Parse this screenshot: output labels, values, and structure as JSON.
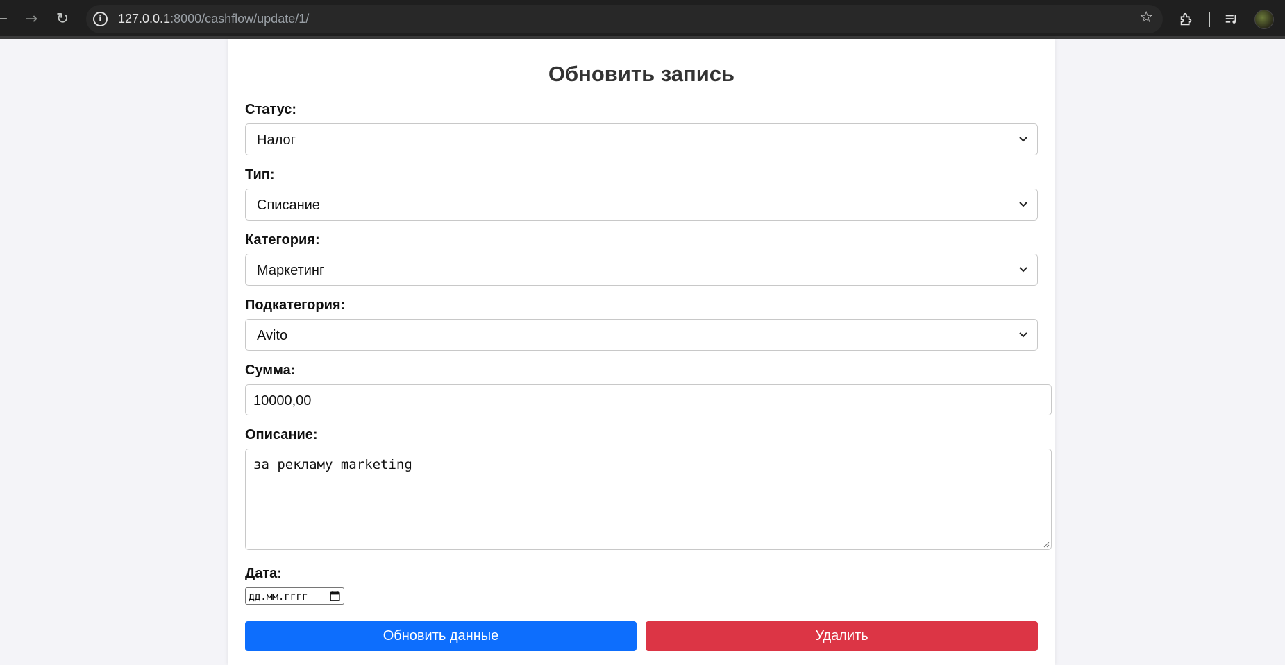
{
  "browser": {
    "url_host": "127.0.0.1",
    "url_rest": ":8000/cashflow/update/1/",
    "back_icon": "back-arrow-icon",
    "forward_icon": "forward-arrow-icon",
    "reload_icon": "reload-icon",
    "site_info_icon": "info-icon",
    "bookmark_icon": "star-icon",
    "extensions_icon": "puzzle-icon",
    "media_icon": "media-queue-icon",
    "profile_icon": "avatar"
  },
  "form": {
    "title": "Обновить запись",
    "status": {
      "label": "Статус:",
      "value": "Налог"
    },
    "type": {
      "label": "Тип:",
      "value": "Списание"
    },
    "category": {
      "label": "Категория:",
      "value": "Маркетинг"
    },
    "subcategory": {
      "label": "Подкатегория:",
      "value": "Avito"
    },
    "amount": {
      "label": "Сумма:",
      "value": "10000,00"
    },
    "description": {
      "label": "Описание:",
      "value": "за рекламу marketing"
    },
    "date": {
      "label": "Дата:",
      "placeholder": "дд.мм.гггг"
    },
    "update_button": "Обновить данные",
    "delete_button": "Удалить"
  },
  "colors": {
    "primary": "#0d6efd",
    "danger": "#dc3545",
    "page_bg": "#f4f4f8",
    "chrome_bg": "#1f1f1f"
  }
}
